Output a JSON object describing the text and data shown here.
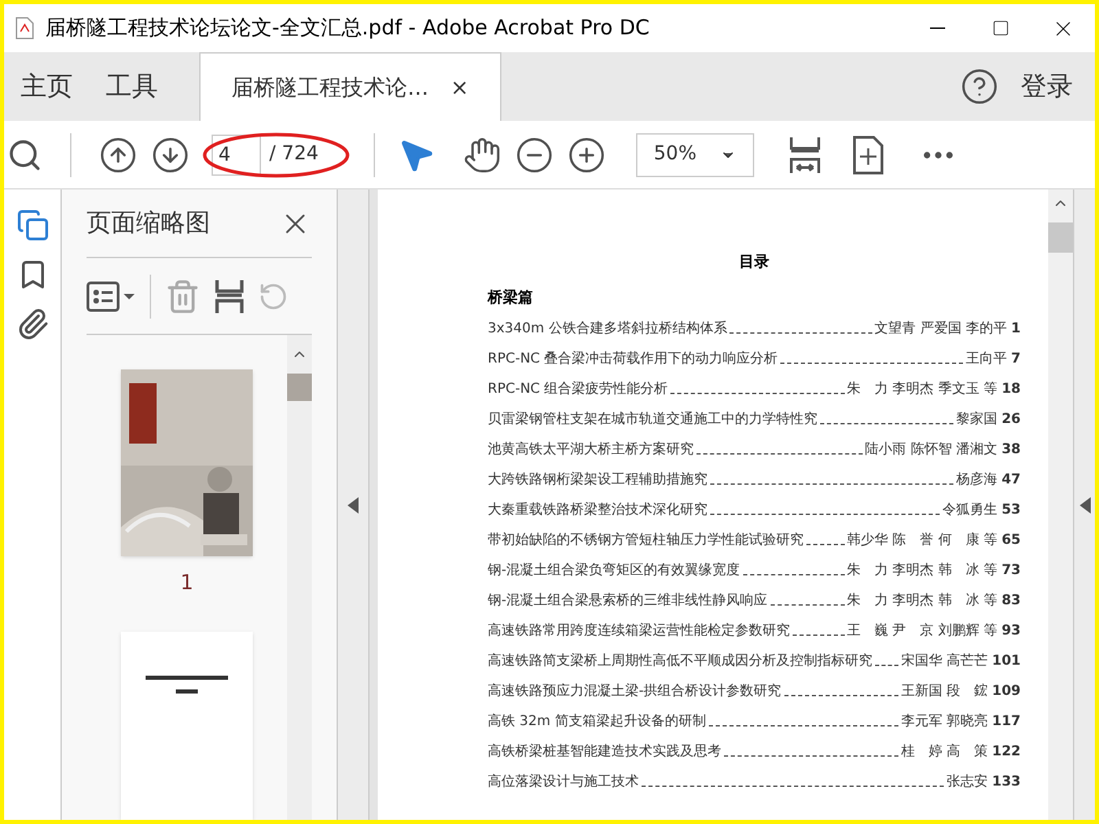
{
  "window": {
    "title": "届桥隧工程技术论坛论文-全文汇总.pdf - Adobe Acrobat Pro DC"
  },
  "nav": [
    {
      "label": "主页"
    },
    {
      "label": "工具"
    }
  ],
  "doc_tab": {
    "label": "届桥隧工程技术论...",
    "close": "×"
  },
  "sign_in": "登录",
  "toolbar": {
    "page_value": "4",
    "page_total": "/ 724",
    "zoom": "50%"
  },
  "panel": {
    "title": "页面缩略图",
    "thumbnails": [
      {
        "kind": "picture",
        "label": "1"
      },
      {
        "kind": "text"
      }
    ]
  },
  "document": {
    "heading": "目录",
    "section": "桥梁篇",
    "entries": [
      {
        "title": "3x340m 公铁合建多塔斜拉桥结构体系",
        "authors": "文望青 严爱国 李的平",
        "page": "1"
      },
      {
        "title": "RPC-NC 叠合梁冲击荷载作用下的动力响应分析",
        "authors": "王向平",
        "page": "7"
      },
      {
        "title": "RPC-NC 组合梁疲劳性能分析",
        "authors": "朱　力 李明杰 季文玉 等",
        "page": "18"
      },
      {
        "title": "贝雷梁钢管柱支架在城市轨道交通施工中的力学特性究",
        "authors": "黎家国",
        "page": "26"
      },
      {
        "title": "池黄高铁太平湖大桥主桥方案研究",
        "authors": "陆小雨 陈怀智 潘湘文",
        "page": "38"
      },
      {
        "title": "大跨铁路钢桁梁架设工程辅助措施究",
        "authors": "杨彦海",
        "page": "47"
      },
      {
        "title": "大秦重载铁路桥梁整治技术深化研究",
        "authors": "令狐勇生",
        "page": "53"
      },
      {
        "title": "带初始缺陷的不锈钢方管短柱轴压力学性能试验研究",
        "authors": "韩少华 陈　誉 何　康 等",
        "page": "65"
      },
      {
        "title": "钢-混凝土组合梁负弯矩区的有效翼缘宽度",
        "authors": "朱　力 李明杰 韩　冰 等",
        "page": "73"
      },
      {
        "title": "钢-混凝土组合梁悬索桥的三维非线性静风响应",
        "authors": "朱　力 李明杰 韩　冰 等",
        "page": "83"
      },
      {
        "title": "高速铁路常用跨度连续箱梁运营性能检定参数研究",
        "authors": "王　巍 尹　京 刘鹏辉 等",
        "page": "93"
      },
      {
        "title": "高速铁路简支梁桥上周期性高低不平顺成因分析及控制指标研究",
        "authors": "宋国华 高芒芒",
        "page": "101"
      },
      {
        "title": "高速铁路预应力混凝土梁-拱组合桥设计参数研究",
        "authors": "王新国 段　鋐",
        "page": "109"
      },
      {
        "title": "高铁 32m 简支箱梁起升设备的研制",
        "authors": "李元军 郭晓亮",
        "page": "117"
      },
      {
        "title": "高铁桥梁桩基智能建造技术实践及思考",
        "authors": "桂　婷 高　策",
        "page": "122"
      },
      {
        "title": "高位落梁设计与施工技术",
        "authors": "张志安",
        "page": "133"
      }
    ]
  }
}
